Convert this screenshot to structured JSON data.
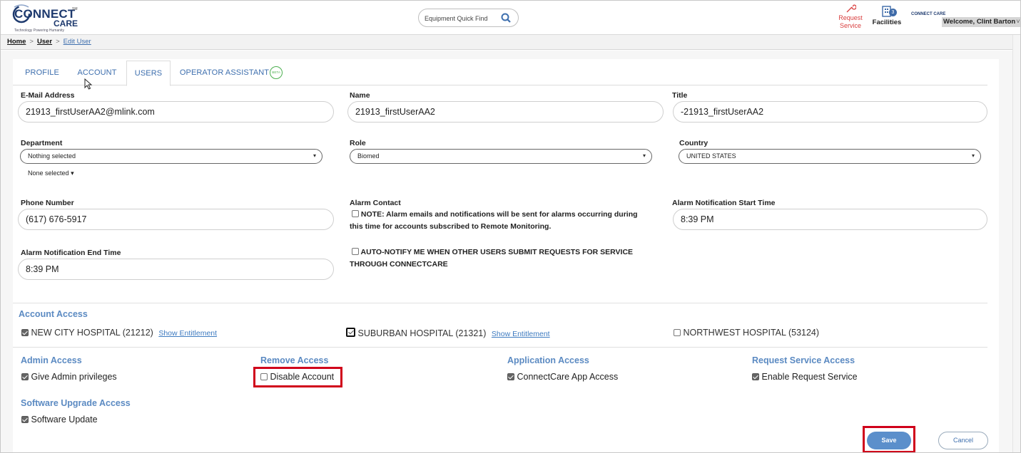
{
  "header": {
    "logo": {
      "word1": "ONNECT",
      "letter": "C",
      "word2": "CARE",
      "tagline": "Technology Powering Humanity",
      "sm": "SM"
    },
    "search_placeholder": "Equipment Quick Find",
    "request_service": [
      "Request",
      "Service"
    ],
    "facilities_label": "Facilities",
    "facilities_count": "3",
    "mini_logo": "CONNECT CARE",
    "welcome": "Welcome, Clint Barton"
  },
  "breadcrumb": {
    "home": "Home",
    "user": "User",
    "current": "Edit User",
    "sep": ">"
  },
  "tabs": [
    "PROFILE",
    "ACCOUNT",
    "USERS",
    "OPERATOR ASSISTANT"
  ],
  "beta_label": "BETA",
  "form": {
    "email": {
      "label": "E-Mail Address",
      "value": "21913_firstUserAA2@mlink.com"
    },
    "name": {
      "label": "Name",
      "value": "21913_firstUserAA2"
    },
    "title": {
      "label": "Title",
      "value": "-21913_firstUserAA2"
    },
    "department": {
      "label": "Department",
      "value": "Nothing selected",
      "sub": "None selected"
    },
    "role": {
      "label": "Role",
      "value": "Biomed"
    },
    "country": {
      "label": "Country",
      "value": "UNITED STATES"
    },
    "phone": {
      "label": "Phone Number",
      "value": "(617) 676-5917"
    },
    "alarm_contact": {
      "label": "Alarm Contact",
      "note_line1": "NOTE: Alarm emails and notifications will be sent for alarms occurring during",
      "note_line2": "this time for accounts subscribed to Remote Monitoring."
    },
    "alarm_start": {
      "label": "Alarm Notification Start Time",
      "value": "8:39 PM"
    },
    "alarm_end": {
      "label": "Alarm Notification End Time",
      "value": "8:39 PM"
    },
    "auto_notify": {
      "line1": "AUTO-NOTIFY ME WHEN OTHER USERS SUBMIT REQUESTS FOR SERVICE",
      "line2": "THROUGH CONNECTCARE"
    }
  },
  "account_access": {
    "title": "Account Access",
    "hospitals": [
      {
        "name": "NEW CITY HOSPITAL (21212)",
        "link": "Show Entitlement",
        "checked": true
      },
      {
        "name": "SUBURBAN HOSPITAL (21321)",
        "link": "Show Entitlement",
        "checked": true
      },
      {
        "name": "NORTHWEST HOSPITAL (53124)",
        "link": "",
        "checked": false
      }
    ]
  },
  "permissions": {
    "admin": {
      "title": "Admin Access",
      "option": "Give Admin privileges",
      "checked": true
    },
    "remove": {
      "title": "Remove Access",
      "option": "Disable Account",
      "checked": false
    },
    "application": {
      "title": "Application Access",
      "option": "ConnectCare App Access",
      "checked": true
    },
    "request_service": {
      "title": "Request Service Access",
      "option": "Enable Request Service",
      "checked": true
    },
    "software": {
      "title": "Software Upgrade Access",
      "option": "Software Update",
      "checked": true
    }
  },
  "buttons": {
    "save": "Save",
    "cancel": "Cancel"
  },
  "colors": {
    "accent": "#3e6fae",
    "highlight": "#d0021b",
    "save": "#5b8fcb"
  }
}
